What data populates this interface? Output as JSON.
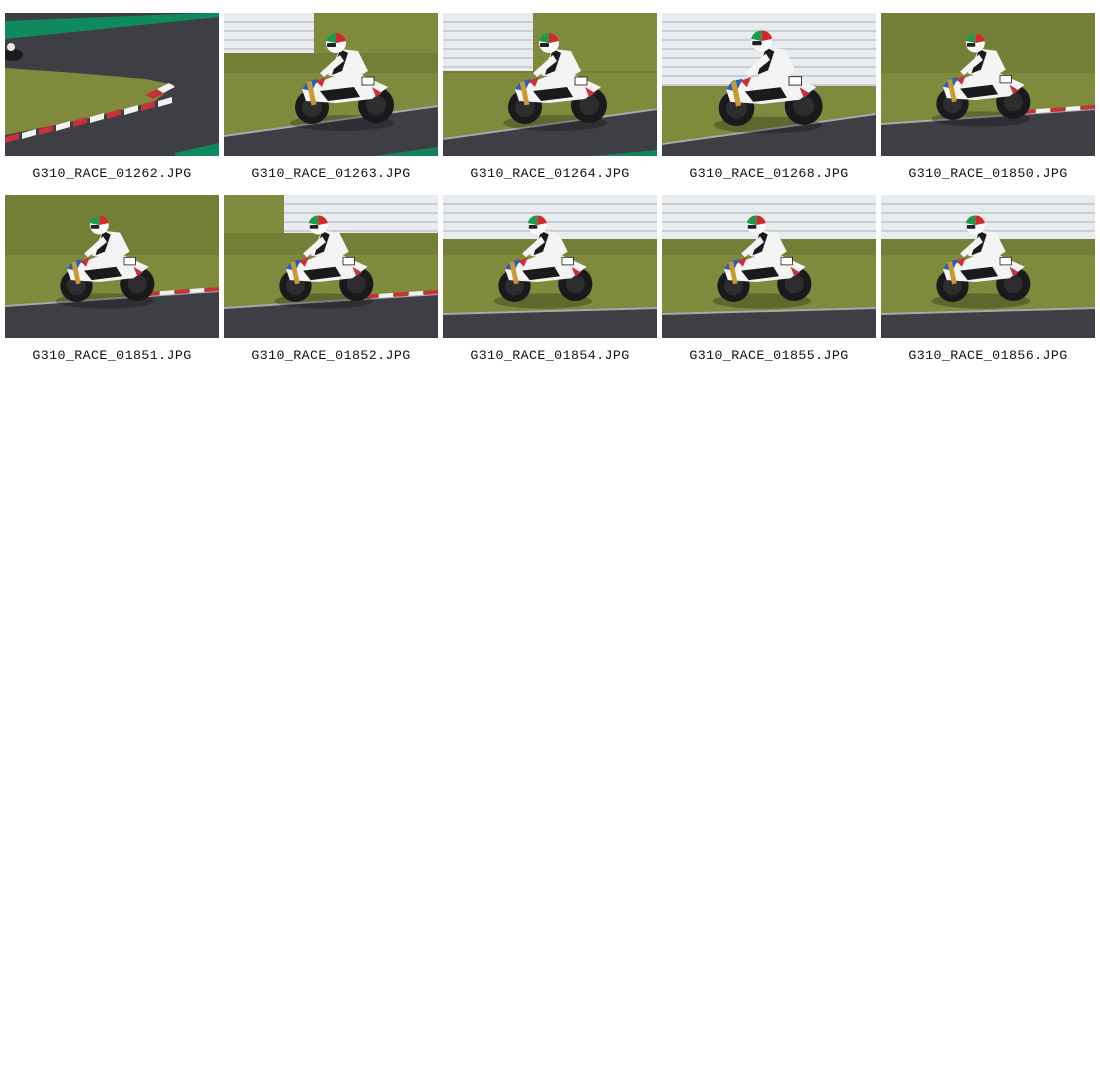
{
  "gallery": {
    "items": [
      {
        "filename": "G310_RACE_01262.JPG",
        "scene": "wide-corner"
      },
      {
        "filename": "G310_RACE_01263.JPG",
        "scene": "grass-left"
      },
      {
        "filename": "G310_RACE_01264.JPG",
        "scene": "barrier-left"
      },
      {
        "filename": "G310_RACE_01268.JPG",
        "scene": "barrier-close"
      },
      {
        "filename": "G310_RACE_01850.JPG",
        "scene": "grass-kerb"
      },
      {
        "filename": "G310_RACE_01851.JPG",
        "scene": "grass-kerb"
      },
      {
        "filename": "G310_RACE_01852.JPG",
        "scene": "grass-barrier"
      },
      {
        "filename": "G310_RACE_01854.JPG",
        "scene": "barrier-wide"
      },
      {
        "filename": "G310_RACE_01855.JPG",
        "scene": "barrier-wide"
      },
      {
        "filename": "G310_RACE_01856.JPG",
        "scene": "barrier-wide"
      }
    ]
  },
  "colors": {
    "grass": "#7f8a3c",
    "grass_dark": "#5e6a2c",
    "asphalt": "#3d3f44",
    "asphalt_light": "#55575c",
    "kerb_red": "#c8303a",
    "kerb_white": "#f2f2f2",
    "barrier": "#e9ecef",
    "green_stripe": "#0f8a5c",
    "bike_white": "#f4f4f4",
    "bike_black": "#1a1a1d",
    "helmet_red": "#d22a2a",
    "helmet_green": "#1f9a4a"
  }
}
